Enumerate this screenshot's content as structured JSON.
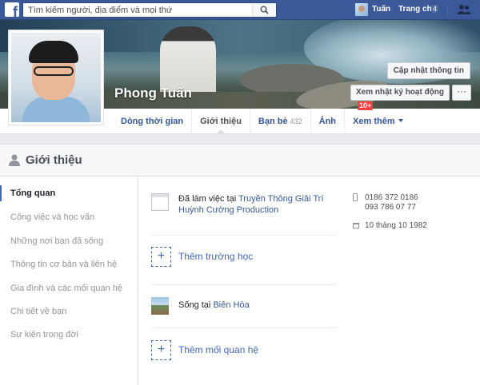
{
  "topbar": {
    "search_placeholder": "Tìm kiếm người, địa điểm và mọi thứ",
    "user_name": "Tuấn",
    "home_label": "Trang chủ",
    "home_count": "4"
  },
  "profile": {
    "name": "Phong Tuấn",
    "update_info_label": "Cập nhật thông tin",
    "activity_log_label": "Xem nhật ký hoạt động",
    "activity_badge": "10+",
    "more_label": "···"
  },
  "tabs": [
    {
      "label": "Dòng thời gian"
    },
    {
      "label": "Giới thiệu"
    },
    {
      "label": "Bạn bè",
      "count": "432"
    },
    {
      "label": "Ảnh"
    },
    {
      "label": "Xem thêm"
    }
  ],
  "about": {
    "title": "Giới thiệu",
    "sidebar": [
      "Tổng quan",
      "Công việc và học vấn",
      "Những nơi bạn đã sống",
      "Thông tin cơ bản và liên hệ",
      "Gia đình và các mối quan hệ",
      "Chi tiết về bạn",
      "Sự kiện trong đời"
    ],
    "work_prefix": "Đã làm việc tại",
    "work_place": "Truyền Thông Giải Trí Huỳnh Cường Production",
    "add_school": "Thêm trường học",
    "lives_prefix": "Sống tại",
    "lives_city": "Biên Hòa",
    "add_relationship": "Thêm mối quan hệ",
    "phone_1": "0186 372 0186",
    "phone_2": "093 786 07 77",
    "birthday": "10 tháng 10 1982"
  },
  "colors": {
    "brand": "#3b5998",
    "link": "#365899",
    "badge": "#fa3e3e"
  }
}
